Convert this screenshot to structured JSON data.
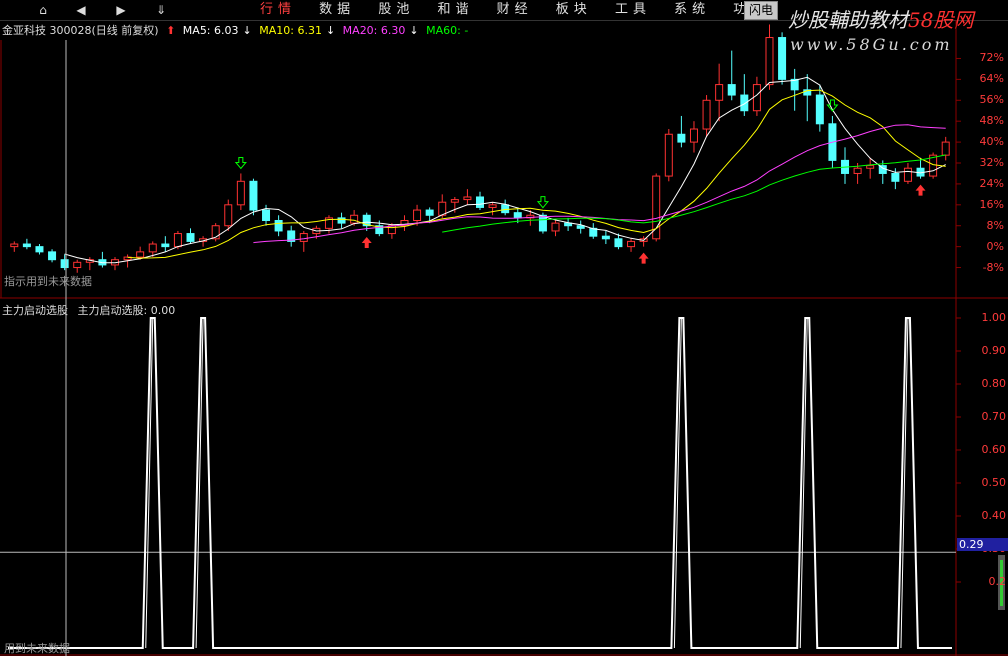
{
  "toolbar": {
    "nav": [
      {
        "name": "home-icon",
        "glyph": "⌂"
      },
      {
        "name": "back-icon",
        "glyph": "◀"
      },
      {
        "name": "forward-icon",
        "glyph": "▶"
      },
      {
        "name": "collapse-icon",
        "glyph": "⇓"
      }
    ],
    "menu": [
      "行情",
      "数据",
      "股池",
      "和谐",
      "财经",
      "板块",
      "工具",
      "系统",
      "功能"
    ],
    "active_menu": "行情",
    "flash_label": "闪电",
    "brand_text": "炒股輔助教材",
    "brand_accent": "58股网",
    "brand_url": "www.58Gu.com"
  },
  "info": {
    "stock": "金亚科技 300028(日线 前复权)",
    "ma5": "MA5: 6.03",
    "ma10": "MA10: 6.31",
    "ma20": "MA20: 6.30",
    "ma60": "MA60: -"
  },
  "hints": {
    "top": "指示用到未来数据",
    "bottom": "用到未来数据"
  },
  "indicator": {
    "title": "主力启动选股",
    "value_text": "主力启动选股: 0.00",
    "current_value": "0.29"
  },
  "colors": {
    "up": "#ff3232",
    "down": "#54ffff",
    "ma5": "#ffffff",
    "ma10": "#ffff00",
    "ma20": "#ff40ff",
    "ma60": "#00ff00",
    "grid": "#8b0000",
    "axis_text": "#ff3b3b"
  },
  "price_axis": [
    "72%",
    "64%",
    "56%",
    "48%",
    "40%",
    "32%",
    "24%",
    "16%",
    "8%",
    "0%",
    "-8%"
  ],
  "indicator_axis": [
    "1.00",
    "0.90",
    "0.80",
    "0.70",
    "0.60",
    "0.50",
    "0.40",
    "0.30",
    "0.2"
  ],
  "chart_data": [
    {
      "type": "candlestick",
      "title": "金亚科技 300028(日线 前复权)",
      "y_axis_percent": [
        72,
        64,
        56,
        48,
        40,
        32,
        24,
        16,
        8,
        0,
        -8
      ],
      "series": [
        {
          "name": "MA5",
          "last": 6.03
        },
        {
          "name": "MA10",
          "last": 6.31
        },
        {
          "name": "MA20",
          "last": 6.3
        },
        {
          "name": "MA60",
          "last": null
        }
      ],
      "candles_pct": [
        [
          0,
          2,
          -2,
          1
        ],
        [
          1,
          3,
          -1,
          0
        ],
        [
          0,
          1,
          -3,
          -2
        ],
        [
          -2,
          -1,
          -6,
          -5
        ],
        [
          -5,
          -3,
          -9,
          -8
        ],
        [
          -8,
          -5,
          -10,
          -6
        ],
        [
          -6,
          -4,
          -9,
          -5
        ],
        [
          -5,
          -2,
          -8,
          -7
        ],
        [
          -7,
          -4,
          -9,
          -5
        ],
        [
          -5,
          -3,
          -8,
          -4
        ],
        [
          -4,
          0,
          -5,
          -2
        ],
        [
          -2,
          2,
          -4,
          1
        ],
        [
          1,
          4,
          -2,
          0
        ],
        [
          0,
          6,
          -1,
          5
        ],
        [
          5,
          7,
          1,
          2
        ],
        [
          2,
          4,
          0,
          3
        ],
        [
          3,
          9,
          2,
          8
        ],
        [
          8,
          18,
          6,
          16
        ],
        [
          16,
          28,
          14,
          25
        ],
        [
          25,
          26,
          12,
          14
        ],
        [
          14,
          16,
          8,
          10
        ],
        [
          10,
          12,
          4,
          6
        ],
        [
          6,
          8,
          0,
          2
        ],
        [
          2,
          6,
          -2,
          5
        ],
        [
          5,
          8,
          3,
          7
        ],
        [
          7,
          12,
          5,
          11
        ],
        [
          11,
          13,
          7,
          9
        ],
        [
          9,
          14,
          8,
          12
        ],
        [
          12,
          13,
          6,
          8
        ],
        [
          8,
          10,
          4,
          5
        ],
        [
          5,
          9,
          3,
          8
        ],
        [
          8,
          12,
          6,
          10
        ],
        [
          10,
          16,
          8,
          14
        ],
        [
          14,
          15,
          9,
          12
        ],
        [
          12,
          20,
          11,
          17
        ],
        [
          17,
          19,
          13,
          18
        ],
        [
          18,
          22,
          16,
          19
        ],
        [
          19,
          21,
          14,
          15
        ],
        [
          15,
          17,
          12,
          16
        ],
        [
          16,
          18,
          12,
          13
        ],
        [
          13,
          15,
          9,
          11
        ],
        [
          11,
          14,
          8,
          12
        ],
        [
          12,
          13,
          5,
          6
        ],
        [
          6,
          10,
          4,
          9
        ],
        [
          9,
          11,
          6,
          8
        ],
        [
          8,
          10,
          5,
          7
        ],
        [
          7,
          9,
          3,
          4
        ],
        [
          4,
          6,
          1,
          3
        ],
        [
          3,
          5,
          -1,
          0
        ],
        [
          0,
          3,
          -2,
          2
        ],
        [
          2,
          4,
          0,
          3
        ],
        [
          3,
          28,
          2,
          27
        ],
        [
          27,
          45,
          25,
          43
        ],
        [
          43,
          50,
          38,
          40
        ],
        [
          40,
          48,
          36,
          45
        ],
        [
          45,
          58,
          42,
          56
        ],
        [
          56,
          70,
          48,
          62
        ],
        [
          62,
          75,
          56,
          58
        ],
        [
          58,
          66,
          50,
          52
        ],
        [
          52,
          65,
          50,
          62
        ],
        [
          62,
          85,
          60,
          80
        ],
        [
          80,
          82,
          62,
          64
        ],
        [
          64,
          68,
          52,
          60
        ],
        [
          60,
          66,
          48,
          58
        ],
        [
          58,
          62,
          44,
          47
        ],
        [
          47,
          50,
          30,
          33
        ],
        [
          33,
          38,
          24,
          28
        ],
        [
          28,
          32,
          24,
          30
        ],
        [
          30,
          34,
          26,
          31
        ],
        [
          31,
          33,
          24,
          28
        ],
        [
          28,
          30,
          22,
          25
        ],
        [
          25,
          32,
          24,
          30
        ],
        [
          30,
          34,
          26,
          27
        ],
        [
          27,
          36,
          26,
          35
        ],
        [
          35,
          42,
          33,
          40
        ]
      ]
    },
    {
      "type": "line",
      "title": "主力启动选股",
      "ylim": [
        0,
        1
      ],
      "spike_values": [
        1.0,
        1.0,
        1.0,
        1.0,
        1.0
      ],
      "base_value": 0.0,
      "current": 0.29
    }
  ]
}
